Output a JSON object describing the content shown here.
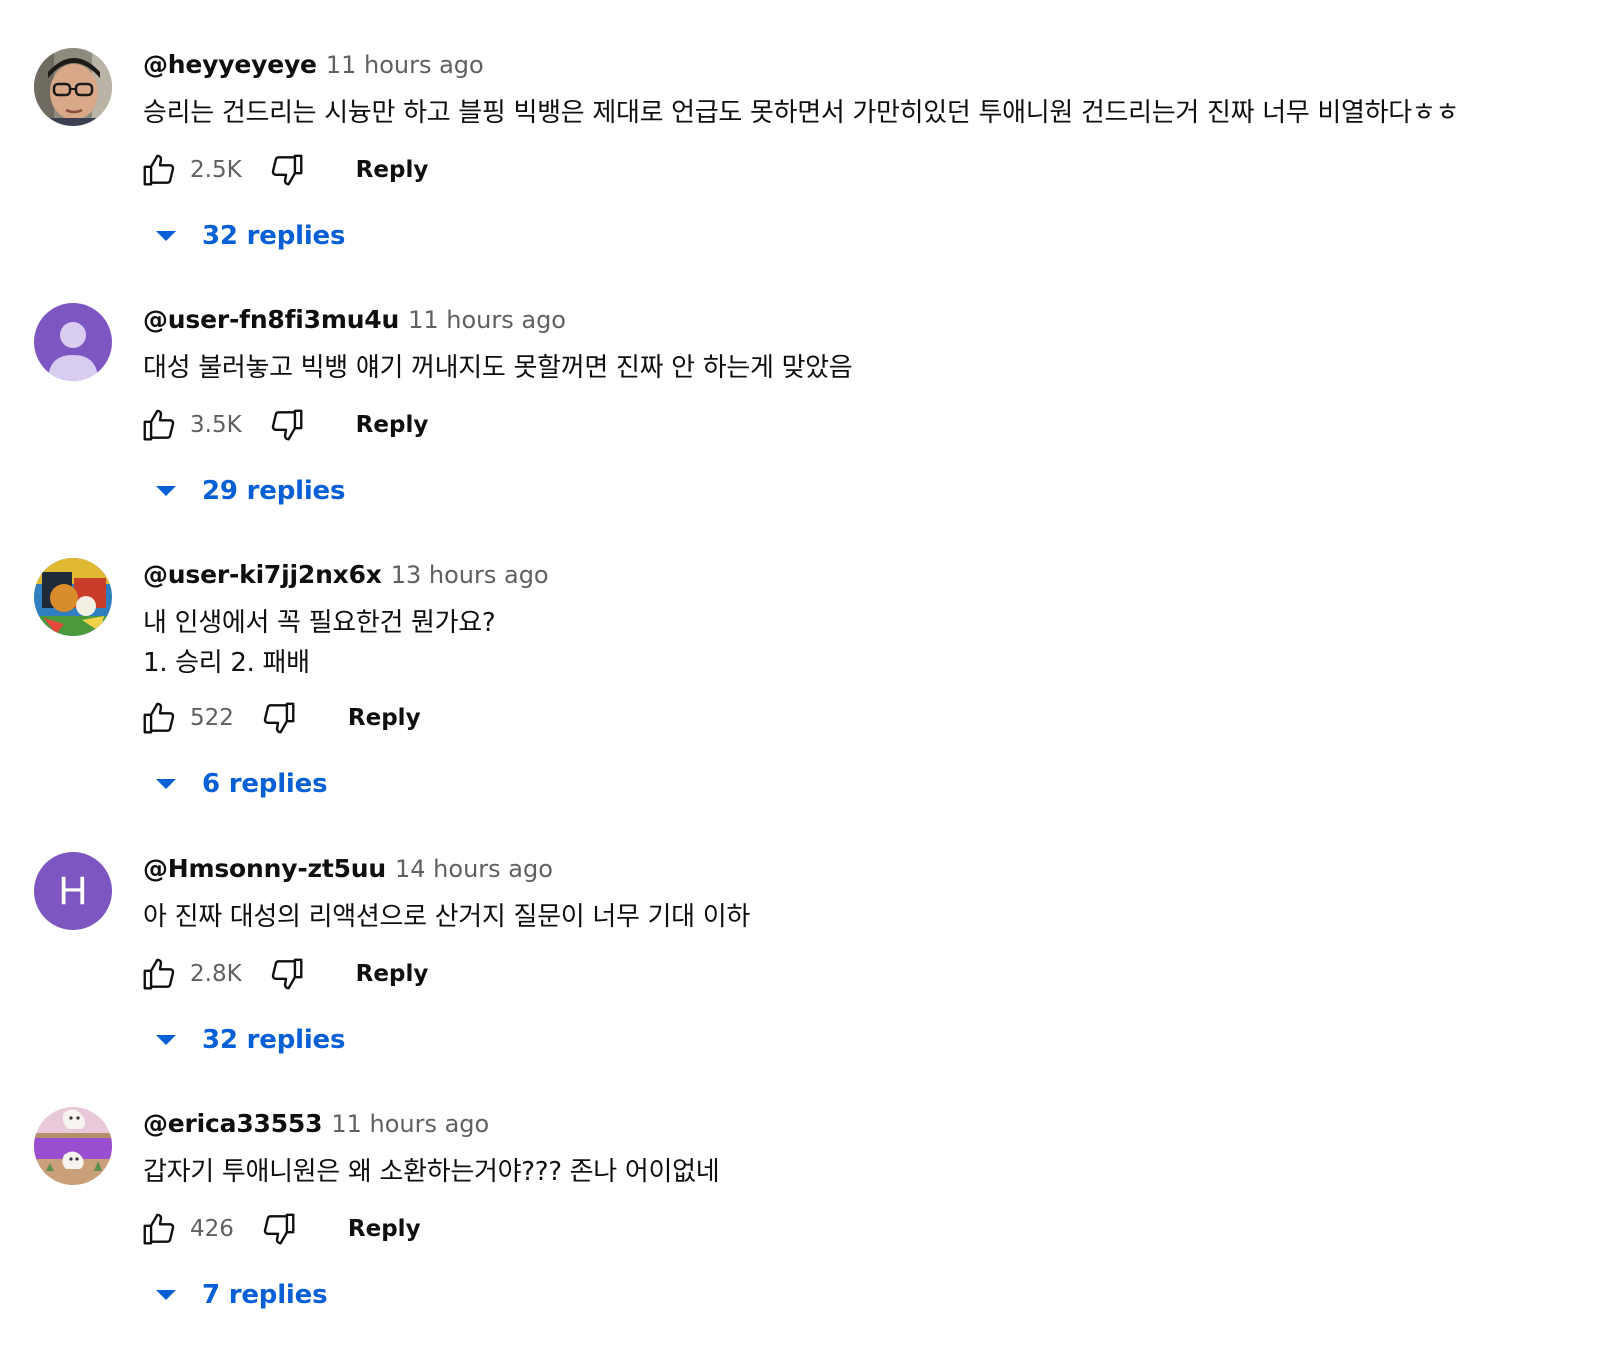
{
  "colors": {
    "link": "#065fd4",
    "secondary_text": "#606060",
    "primary_text": "#0f0f0f"
  },
  "comments": [
    {
      "author": "@heyyeyeye",
      "time": "11 hours ago",
      "text": "승리는 건드리는 시늉만 하고 블핑 빅뱅은 제대로 언급도 못하면서 가만히있던 투애니원 건드리는거 진짜 너무 비열하다ㅎㅎ",
      "likes": "2.5K",
      "reply_label": "Reply",
      "replies_label": "32 replies",
      "avatar": "photo-avatar-boy-glasses"
    },
    {
      "author": "@user-fn8fi3mu4u",
      "time": "11 hours ago",
      "text": "대성 불러놓고 빅뱅 얘기 꺼내지도 못할꺼면 진짜 안 하는게 맞았음",
      "likes": "3.5K",
      "reply_label": "Reply",
      "replies_label": "29 replies",
      "avatar": "default-person-avatar"
    },
    {
      "author": "@user-ki7jj2nx6x",
      "time": "13 hours ago",
      "text": "내 인생에서 꼭 필요한건 뭔가요?\n1. 승리 2. 패배",
      "likes": "522",
      "reply_label": "Reply",
      "replies_label": "6 replies",
      "avatar": "painting-avatar"
    },
    {
      "author": "@Hmsonny-zt5uu",
      "time": "14 hours ago",
      "text": "아 진짜 대성의 리액션으로 산거지 질문이 너무 기대 이하",
      "likes": "2.8K",
      "reply_label": "Reply",
      "replies_label": "32 replies",
      "avatar_letter": "H",
      "avatar": "letter-avatar"
    },
    {
      "author": "@erica33553",
      "time": "11 hours ago",
      "text": "갑자기 투애니원은 왜 소환하는거야??? 존나 어이없네",
      "likes": "426",
      "reply_label": "Reply",
      "replies_label": "7 replies",
      "avatar": "cartoon-ghost-avatar"
    }
  ]
}
